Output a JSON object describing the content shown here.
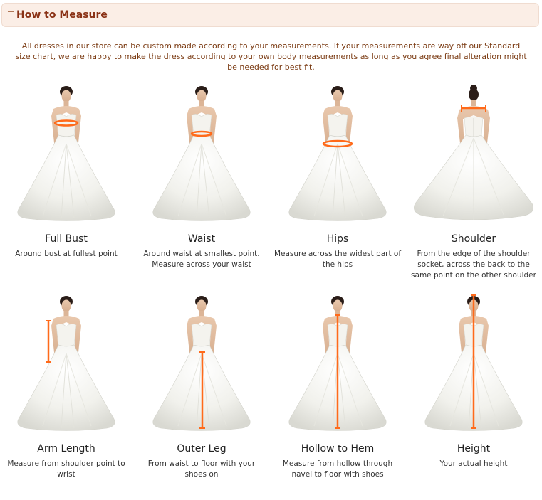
{
  "header": {
    "title": "How to Measure"
  },
  "intro": "All dresses in our store can be custom made according to your measurements. If your measurements are way off our Standard size chart, we are happy to make the dress according to your own body measurements as long as you agree final alteration might be needed for best fit.",
  "colors": {
    "accent": "#8a3216",
    "measure_line": "#ff6a1a",
    "header_bg": "#fbeee6"
  },
  "measurements": [
    {
      "title": "Full Bust",
      "desc": "Around bust at fullest point",
      "marker": "bust-band"
    },
    {
      "title": "Waist",
      "desc": "Around waist at smallest point. Measure across your waist",
      "marker": "waist-band"
    },
    {
      "title": "Hips",
      "desc": "Measure across the widest part of the hips",
      "marker": "hips-band"
    },
    {
      "title": "Shoulder",
      "desc": "From the edge of the shoulder socket, across the back to the same point on the other shoulder",
      "marker": "shoulder-line"
    },
    {
      "title": "Arm Length",
      "desc": "Measure from shoulder point to wrist",
      "marker": "arm-line"
    },
    {
      "title": "Outer Leg",
      "desc": "From waist to floor with your shoes on",
      "marker": "outer-leg-line"
    },
    {
      "title": "Hollow to Hem",
      "desc": "Measure from hollow through navel to floor with shoes",
      "marker": "hollow-hem-line"
    },
    {
      "title": "Height",
      "desc": "Your actual height",
      "marker": "height-line"
    }
  ]
}
